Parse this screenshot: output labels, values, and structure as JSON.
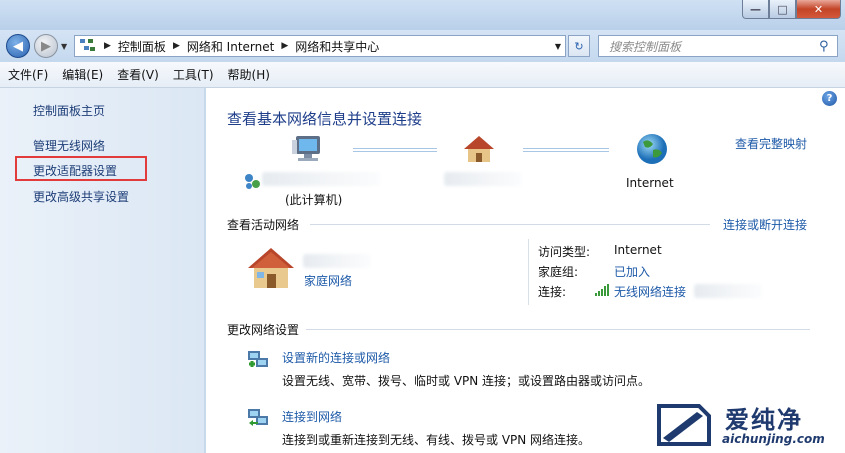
{
  "window": {
    "min_glyph": "—",
    "max_glyph": "□",
    "close_glyph": "✕"
  },
  "nav": {
    "back_glyph": "◀",
    "forward_glyph": "▶"
  },
  "address": {
    "crumbs": [
      "控制面板",
      "网络和 Internet",
      "网络和共享中心"
    ],
    "refresh_glyph": "↻"
  },
  "search": {
    "placeholder": "搜索控制面板"
  },
  "menu": [
    "文件(F)",
    "编辑(E)",
    "查看(V)",
    "工具(T)",
    "帮助(H)"
  ],
  "sidebar": {
    "home": "控制面板主页",
    "items": [
      "管理无线网络",
      "更改适配器设置",
      "更改高级共享设置"
    ],
    "highlighted_item": "更改适配器设置"
  },
  "main": {
    "title": "查看基本网络信息并设置连接",
    "full_map": "查看完整映射",
    "map": {
      "computer_label": "(此计算机)",
      "internet_label": "Internet"
    },
    "active": {
      "header": "查看活动网络",
      "connect_link": "连接或断开连接",
      "network_type": "家庭网络",
      "access_type_label": "访问类型:",
      "access_type_value": "Internet",
      "homegroup_label": "家庭组:",
      "homegroup_value": "已加入",
      "connections_label": "连接:",
      "connections_value": "无线网络连接"
    },
    "change": {
      "header": "更改网络设置",
      "tasks": [
        {
          "title": "设置新的连接或网络",
          "desc": "设置无线、宽带、拨号、临时或 VPN 连接；或设置路由器或访问点。"
        },
        {
          "title": "连接到网络",
          "desc": "连接到或重新连接到无线、有线、拨号或 VPN 网络连接。"
        }
      ]
    }
  },
  "watermark": {
    "name": "爱纯净",
    "url": "aichunjing.com"
  },
  "colors": {
    "link": "#1e5aa8",
    "title": "#1e3e8a",
    "highlight_box": "#e23b3b"
  }
}
